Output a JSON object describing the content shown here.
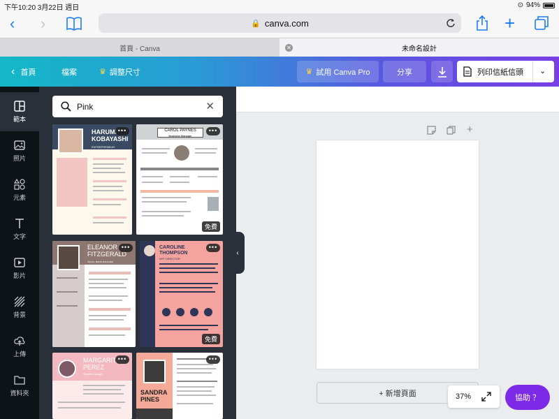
{
  "status_bar": {
    "time_date": "下午10:20  3月22日 週日",
    "battery": "94%"
  },
  "browser": {
    "url": "canva.com"
  },
  "tabs": [
    {
      "label": "首頁 - Canva"
    },
    {
      "label": "未命名設計"
    }
  ],
  "header": {
    "home_label": "首頁",
    "file_label": "檔案",
    "resize_label": "調整尺寸",
    "try_pro_label": "試用 Canva Pro",
    "share_label": "分享",
    "print_label": "列印信紙信頭"
  },
  "sidebar": {
    "items": [
      {
        "label": "範本",
        "icon": "template-icon"
      },
      {
        "label": "照片",
        "icon": "photo-icon"
      },
      {
        "label": "元素",
        "icon": "elements-icon"
      },
      {
        "label": "文字",
        "icon": "text-icon"
      },
      {
        "label": "影片",
        "icon": "video-icon"
      },
      {
        "label": "背景",
        "icon": "background-icon"
      },
      {
        "label": "上傳",
        "icon": "upload-icon"
      },
      {
        "label": "資料夾",
        "icon": "folder-icon"
      }
    ]
  },
  "search": {
    "value": "Pink"
  },
  "templates": [
    {
      "name_line1": "HARUMI",
      "name_line2": "KOBAYASHI",
      "subtitle": "ENTREPRENEUR",
      "free": false
    },
    {
      "name_line1": "CAROL PAYNES",
      "subtitle": "Business Manager",
      "free": true,
      "free_label": "免費"
    },
    {
      "name_line1": "ELEANOR",
      "name_line2": "FITZGERALD",
      "subtitle": "SOCIAL MEDIA MANAGER",
      "free": false
    },
    {
      "name_line1": "CAROLINE",
      "name_line2": "THOMPSON",
      "subtitle": "ART DIRECTOR",
      "free": true,
      "free_label": "免費"
    },
    {
      "name_line1": "MARGARITA",
      "name_line2": "PEREZ",
      "subtitle": "Graphic Design",
      "free": false
    },
    {
      "name_line1": "SANDRA",
      "name_line2": "PINES",
      "subtitle": "",
      "free": false
    }
  ],
  "canvas": {
    "add_page_label": "+ 新增頁面",
    "zoom_label": "37%",
    "help_label": "協助 ？"
  },
  "colors": {
    "header_gradient_start": "#14b8c8",
    "header_gradient_end": "#7a3fe4",
    "help_button": "#7d2ae8",
    "rail_bg": "#0e1318",
    "panel_bg": "#293039"
  }
}
